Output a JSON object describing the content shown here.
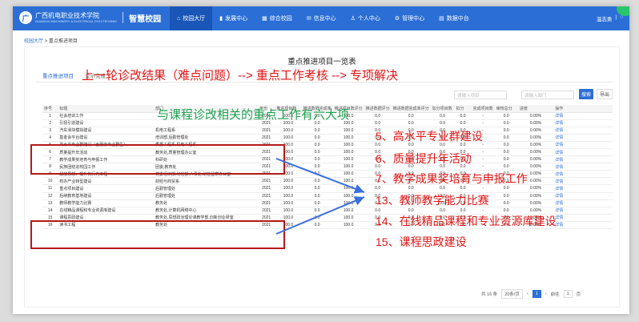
{
  "header": {
    "logo_emblem": "广",
    "school_name": "广西机电职业技术学院",
    "school_name_en": "GUANGXI MACHINERY & ELECTRICAL POLYTECHNIC",
    "product_name": "智慧校园",
    "nav": [
      {
        "label": "校园大厅",
        "icon": "home-icon",
        "glyph": "⌂"
      },
      {
        "label": "发展中心",
        "icon": "chart-icon",
        "glyph": "▮"
      },
      {
        "label": "综合校园",
        "icon": "grid-icon",
        "glyph": "▦"
      },
      {
        "label": "信息中心",
        "icon": "mail-icon",
        "glyph": "✉"
      },
      {
        "label": "个人中心",
        "icon": "user-icon",
        "glyph": "♙"
      },
      {
        "label": "管理中心",
        "icon": "gear-icon",
        "glyph": "⚙"
      },
      {
        "label": "数据中台",
        "icon": "database-icon",
        "glyph": "▤"
      }
    ],
    "user_name": "温志勇",
    "user_sep": "|",
    "user_extra": "○"
  },
  "breadcrumb": {
    "root": "校园大厅",
    "sep": ">",
    "current": "重点推进项目"
  },
  "page_title": "重点推进项目一览表",
  "tabs": [
    "重点推进项目",
    "公示完成"
  ],
  "filters": {
    "project": "请输入项目",
    "dept": "请输入部门"
  },
  "buttons": {
    "search": "搜索",
    "export": "导出"
  },
  "table": {
    "columns": [
      "序号",
      "标题",
      "部门",
      "年份",
      "推进项目数",
      "推进数据完成率",
      "推进项目数评分",
      "推进数据评分",
      "推进数据完成率评分",
      "加分项目数",
      "扣分",
      "完成项目数",
      "审核总分",
      "进度",
      "操作"
    ],
    "rows": [
      [
        "1",
        "社会培训工作",
        "",
        "2021",
        "100.0",
        "0.0",
        "100.0",
        "0.0",
        "0.0",
        "0.0",
        "0.0",
        "-",
        "0.0",
        "0.00%",
        "详情"
      ],
      [
        "2",
        "引招引进建设",
        "",
        "2021",
        "100.0",
        "0.0",
        "100.0",
        "0.0",
        "0.0",
        "0.0",
        "0.0",
        "-",
        "0.0",
        "0.00%",
        "详情"
      ],
      [
        "3",
        "汽车滑块模拟建设",
        "机电工程系",
        "2021",
        "100.0",
        "0.0",
        "100.0",
        "0.0",
        "0.0",
        "0.0",
        "0.0",
        "-",
        "0.0",
        "0.00%",
        "详情"
      ],
      [
        "4",
        "基金会平台建设",
        "培训部,后勤管理处",
        "2021",
        "100.0",
        "0.0",
        "100.0",
        "0.0",
        "0.0",
        "0.0",
        "0.0",
        "-",
        "0.0",
        "0.00%",
        "详情"
      ],
      [
        "5",
        "高水平专业群建设（含服务专业群生）",
        "质量工程系,机电工程系",
        "2021",
        "100.0",
        "0.0",
        "100.0",
        "0.0",
        "0.0",
        "0.0",
        "0.0",
        "-",
        "0.0",
        "0.00%",
        "详情"
      ],
      [
        "6",
        "质量提升年活动",
        "教务处,质量管理办公室",
        "2021",
        "100.0",
        "0.0",
        "100.0",
        "0.0",
        "0.0",
        "0.0",
        "0.0",
        "-",
        "0.0",
        "0.00%",
        "详情"
      ],
      [
        "7",
        "教学成果奖培育与申报工作",
        "科研处",
        "2021",
        "100.0",
        "0.0",
        "100.0",
        "0.0",
        "0.0",
        "0.0",
        "0.0",
        "-",
        "0.0",
        "0.00%",
        "详情"
      ],
      [
        "8",
        "民族团结进校园工作",
        "团委,教育处",
        "2021",
        "100.0",
        "0.0",
        "100.0",
        "0.0",
        "0.0",
        "0.0",
        "0.0",
        "-",
        "0.0",
        "0.00%",
        "详情"
      ],
      [
        "9",
        "解放思想、提升执行力工程",
        "党委组织部,纪检部,人事处,纪检监察办公室",
        "2021",
        "100.0",
        "0.0",
        "100.0",
        "0.0",
        "0.0",
        "0.0",
        "0.0",
        "-",
        "0.0",
        "0.00%",
        "详情"
      ],
      [
        "10",
        "校办产业转型建设",
        "财经与商贸系",
        "2021",
        "100.0",
        "0.0",
        "100.0",
        "0.0",
        "0.0",
        "0.0",
        "0.0",
        "-",
        "0.0",
        "0.00%",
        "详情"
      ],
      [
        "11",
        "重点项目建设",
        "后勤管理处",
        "2021",
        "100.0",
        "0.0",
        "100.0",
        "0.0",
        "0.0",
        "0.0",
        "0.0",
        "-",
        "0.0",
        "0.00%",
        "详情"
      ],
      [
        "12",
        "后续教育基地建设",
        "后勤管理处",
        "2021",
        "100.0",
        "0.0",
        "100.0",
        "0.0",
        "0.0",
        "0.0",
        "0.0",
        "-",
        "0.0",
        "0.00%",
        "详情"
      ],
      [
        "13",
        "教师教学能力比赛",
        "教务处",
        "2021",
        "100.0",
        "0.0",
        "100.0",
        "0.0",
        "0.0",
        "0.0",
        "0.0",
        "-",
        "0.0",
        "0.00%",
        "详情"
      ],
      [
        "14",
        "在线精品课程和专业资源库建设",
        "教务处,计算机网络中心",
        "2021",
        "100.0",
        "0.0",
        "100.0",
        "0.0",
        "0.0",
        "0.0",
        "0.0",
        "-",
        "0.0",
        "0.00%",
        "详情"
      ],
      [
        "15",
        "课程思政建设",
        "教务处,思想政治理论课教学部,创新创业研室",
        "2021",
        "100.0",
        "0.0",
        "100.0",
        "0.0",
        "0.0",
        "0.0",
        "0.0",
        "-",
        "0.0",
        "0.00%",
        "详情"
      ],
      [
        "16",
        "读书工程",
        "教务处",
        "2021",
        "100.0",
        "0.0",
        "100.0",
        "0.0",
        "0.0",
        "0.0",
        "0.0",
        "-",
        "0.0",
        "0.00%",
        "详情"
      ]
    ]
  },
  "pager": {
    "total": "共 16 条",
    "page_size": "20条/页",
    "prev": "‹",
    "current": "1",
    "next": "›",
    "goto_prefix": "前往",
    "goto_value": "1",
    "goto_suffix": "页"
  },
  "annotations": {
    "title": "上一轮诊改结果（难点问题）--> 重点工作考核 --> 专项解决",
    "subtitle": "与课程诊改相关的重点工作有六大项",
    "items": [
      "5、高水平专业群建设",
      "6、质量提升年活动",
      "7、教学成果奖培育与申报工作",
      "13、教师教学能力比赛",
      "14、在线精品课程和专业资源库建设",
      "15、课程思政建设"
    ]
  },
  "colors": {
    "brand": "#2b6fd6",
    "annotation_red": "#e21414",
    "annotation_green": "#1da050",
    "box_red": "#b31919",
    "arrow_blue": "#3a6fe0"
  }
}
